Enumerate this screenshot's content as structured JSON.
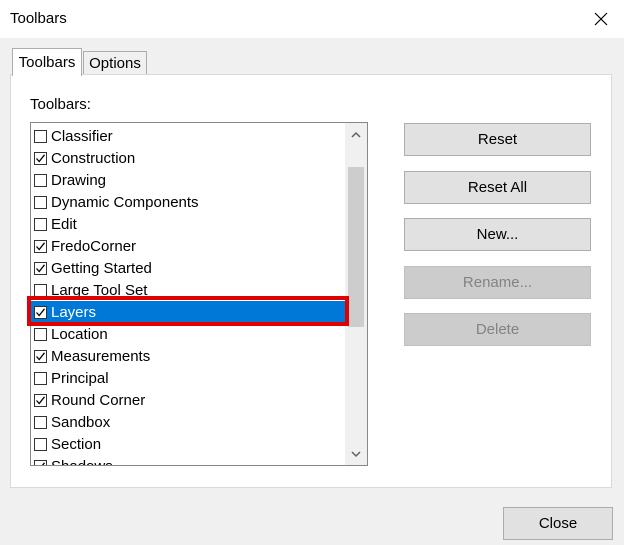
{
  "window": {
    "title": "Toolbars"
  },
  "tabs": [
    {
      "label": "Toolbars"
    },
    {
      "label": "Options"
    }
  ],
  "toolbars_section": {
    "label": "Toolbars:",
    "items": [
      {
        "label": "Classifier",
        "checked": false
      },
      {
        "label": "Construction",
        "checked": true
      },
      {
        "label": "Drawing",
        "checked": false
      },
      {
        "label": "Dynamic Components",
        "checked": false
      },
      {
        "label": "Edit",
        "checked": false
      },
      {
        "label": "FredoCorner",
        "checked": true
      },
      {
        "label": "Getting Started",
        "checked": true
      },
      {
        "label": "Large Tool Set",
        "checked": false
      },
      {
        "label": "Layers",
        "checked": true,
        "selected": true
      },
      {
        "label": "Location",
        "checked": false
      },
      {
        "label": "Measurements",
        "checked": true
      },
      {
        "label": "Principal",
        "checked": false
      },
      {
        "label": "Round Corner",
        "checked": true
      },
      {
        "label": "Sandbox",
        "checked": false
      },
      {
        "label": "Section",
        "checked": false
      },
      {
        "label": "Shadows",
        "checked": true
      }
    ]
  },
  "buttons": {
    "reset": "Reset",
    "reset_all": "Reset All",
    "new": "New...",
    "rename": "Rename...",
    "delete": "Delete",
    "close": "Close"
  },
  "colors": {
    "selection": "#0078d7",
    "highlight_box": "#e00000"
  },
  "icons": {
    "close": "close-icon",
    "check": "checkmark-icon",
    "scroll_up": "chevron-up-icon",
    "scroll_down": "chevron-down-icon"
  }
}
